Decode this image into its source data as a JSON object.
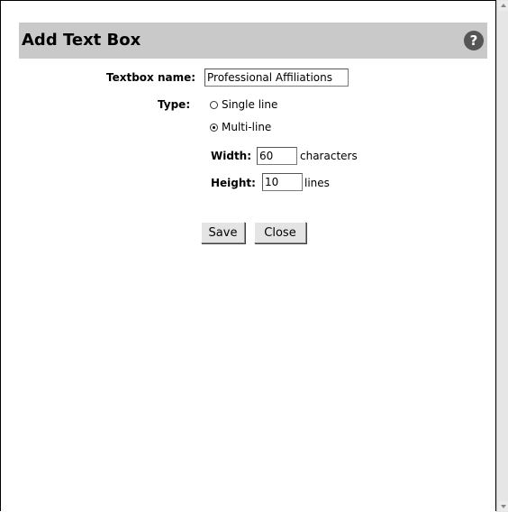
{
  "dialog": {
    "title": "Add Text Box",
    "help_icon_glyph": "?"
  },
  "form": {
    "name_label": "Textbox name:",
    "name_value": "Professional Affiliations",
    "type_label": "Type:",
    "type_options": [
      {
        "label": "Single line",
        "selected": false
      },
      {
        "label": "Multi-line",
        "selected": true
      }
    ],
    "width_label": "Width:",
    "width_value": "60",
    "width_unit": "characters",
    "height_label": "Height:",
    "height_value": "10",
    "height_unit": "lines"
  },
  "buttons": {
    "save_label": "Save",
    "close_label": "Close"
  }
}
